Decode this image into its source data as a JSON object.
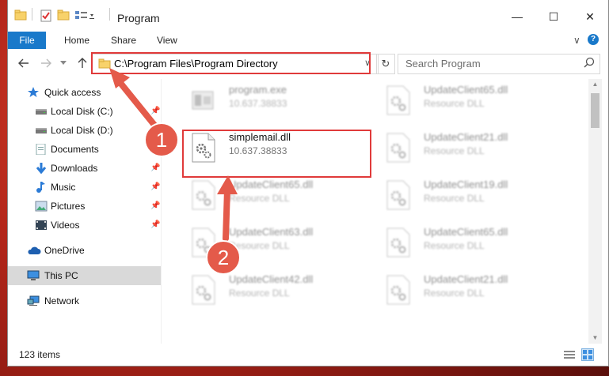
{
  "window": {
    "title": "Program",
    "controls": {
      "minimize": "—",
      "maximize": "☐",
      "close": "✕"
    }
  },
  "ribbon": {
    "tabs": [
      "File",
      "Home",
      "Share",
      "View"
    ],
    "expand": "∨",
    "help": "?"
  },
  "address": {
    "path": "C:\\Program Files\\Program Directory",
    "dropdown": "∨",
    "refresh": "↻"
  },
  "search": {
    "placeholder": "Search Program"
  },
  "nav": {
    "items": [
      {
        "label": "Quick access",
        "icon": "star-icon"
      },
      {
        "label": "Local Disk (C:)",
        "icon": "drive-icon",
        "pinned": true
      },
      {
        "label": "Local Disk (D:)",
        "icon": "drive-icon",
        "pinned": true
      },
      {
        "label": "Documents",
        "icon": "documents-icon",
        "pinned": true
      },
      {
        "label": "Downloads",
        "icon": "download-icon",
        "pinned": true
      },
      {
        "label": "Music",
        "icon": "music-icon",
        "pinned": true
      },
      {
        "label": "Pictures",
        "icon": "pictures-icon",
        "pinned": true
      },
      {
        "label": "Videos",
        "icon": "videos-icon",
        "pinned": true
      },
      {
        "label": "OneDrive",
        "icon": "cloud-icon"
      },
      {
        "label": "This PC",
        "icon": "computer-icon",
        "selected": true
      },
      {
        "label": "Network",
        "icon": "network-icon"
      }
    ]
  },
  "files": {
    "left": [
      {
        "name": "program.exe",
        "sub": "10.637.38833"
      },
      {
        "name": "simplemail.dll",
        "sub": "10.637.38833"
      },
      {
        "name": "UpdateClient65.dll",
        "sub": "Resource DLL"
      },
      {
        "name": "UpdateClient63.dll",
        "sub": "Resource DLL"
      },
      {
        "name": "UpdateClient42.dll",
        "sub": "Resource DLL"
      }
    ],
    "right": [
      {
        "name": "UpdateClient65.dll",
        "sub": "Resource DLL"
      },
      {
        "name": "UpdateClient21.dll",
        "sub": "Resource DLL"
      },
      {
        "name": "UpdateClient19.dll",
        "sub": "Resource DLL"
      },
      {
        "name": "UpdateClient65.dll",
        "sub": "Resource DLL"
      },
      {
        "name": "UpdateClient21.dll",
        "sub": "Resource DLL"
      }
    ]
  },
  "status": {
    "count": "123 items"
  },
  "annotations": {
    "step1": "1",
    "step2": "2"
  },
  "colors": {
    "accent": "#1979ca",
    "highlight": "#e03a3a",
    "badge": "#e45a4a",
    "selected": "#d9d9d9"
  }
}
